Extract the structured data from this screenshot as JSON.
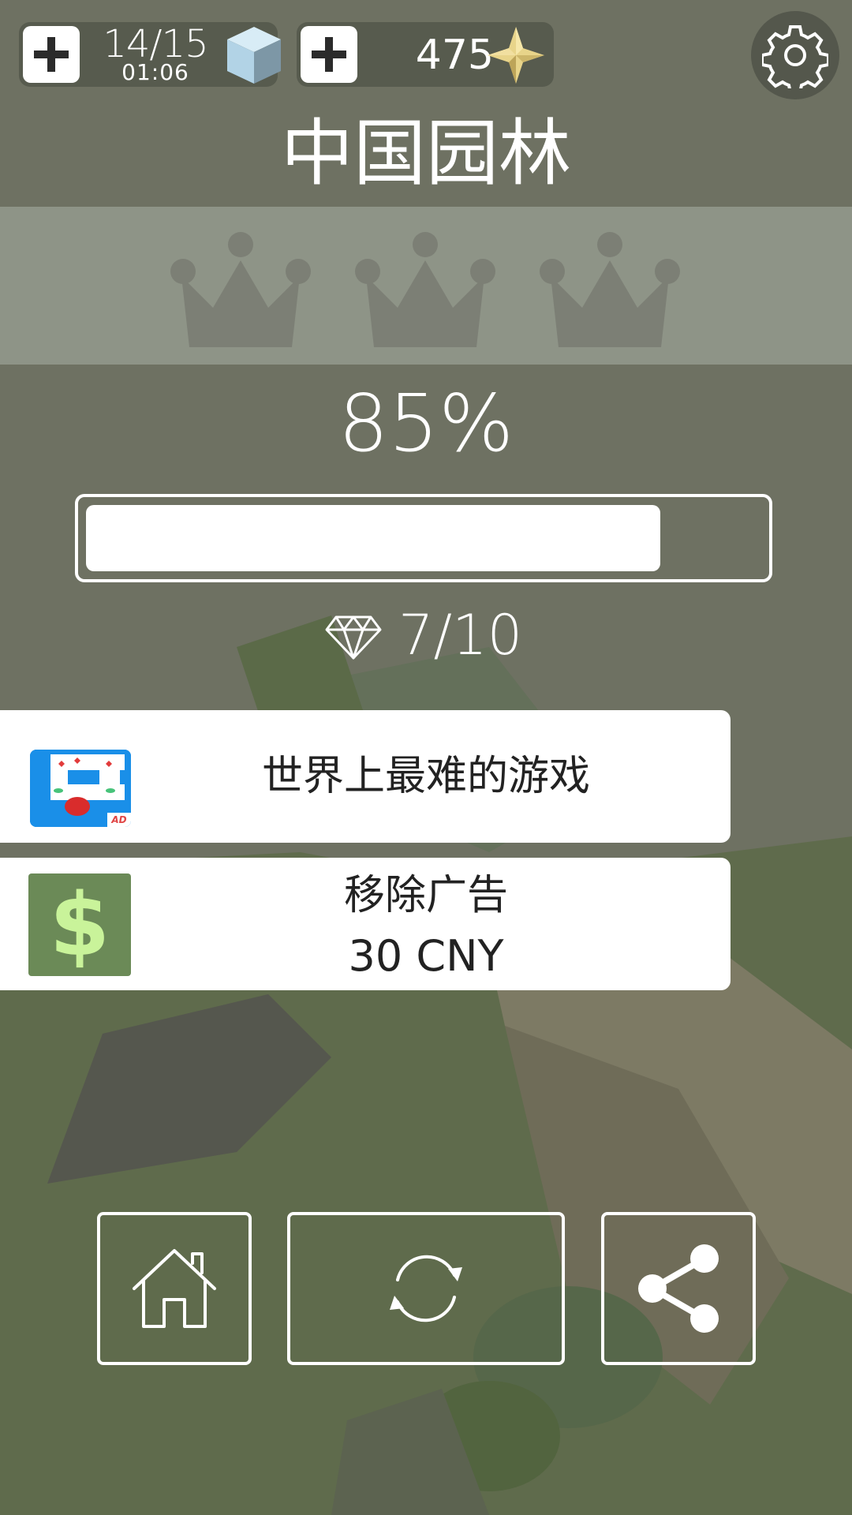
{
  "hud": {
    "energy_count": "14/15",
    "energy_timer": "01:06",
    "stars_count": "475"
  },
  "level": {
    "title": "中国园林",
    "crowns_earned": 0,
    "crowns_total": 3,
    "percent_text": "85%",
    "progress_fraction": 0.85,
    "gems_text": "7/10"
  },
  "ad_card": {
    "label": "世界上最难的游戏",
    "badge": "AD"
  },
  "remove_ads": {
    "label": "移除广告",
    "price": "30 CNY"
  },
  "icons": {
    "energy_plus": "plus-icon",
    "energy": "cube-icon",
    "stars_plus": "plus-icon",
    "stars": "star-icon",
    "settings": "gear-icon",
    "crown": "crown-icon",
    "gem": "diamond-icon",
    "dollar": "dollar-icon",
    "home": "home-icon",
    "restart": "restart-icon",
    "share": "share-icon"
  },
  "colors": {
    "overlay": "#6c6f5f",
    "crown": "#7c7f75",
    "dollar_bg": "#6b8a57",
    "dollar_fg": "#c9f39a",
    "card": "#ffffff",
    "text_dark": "#222222"
  }
}
